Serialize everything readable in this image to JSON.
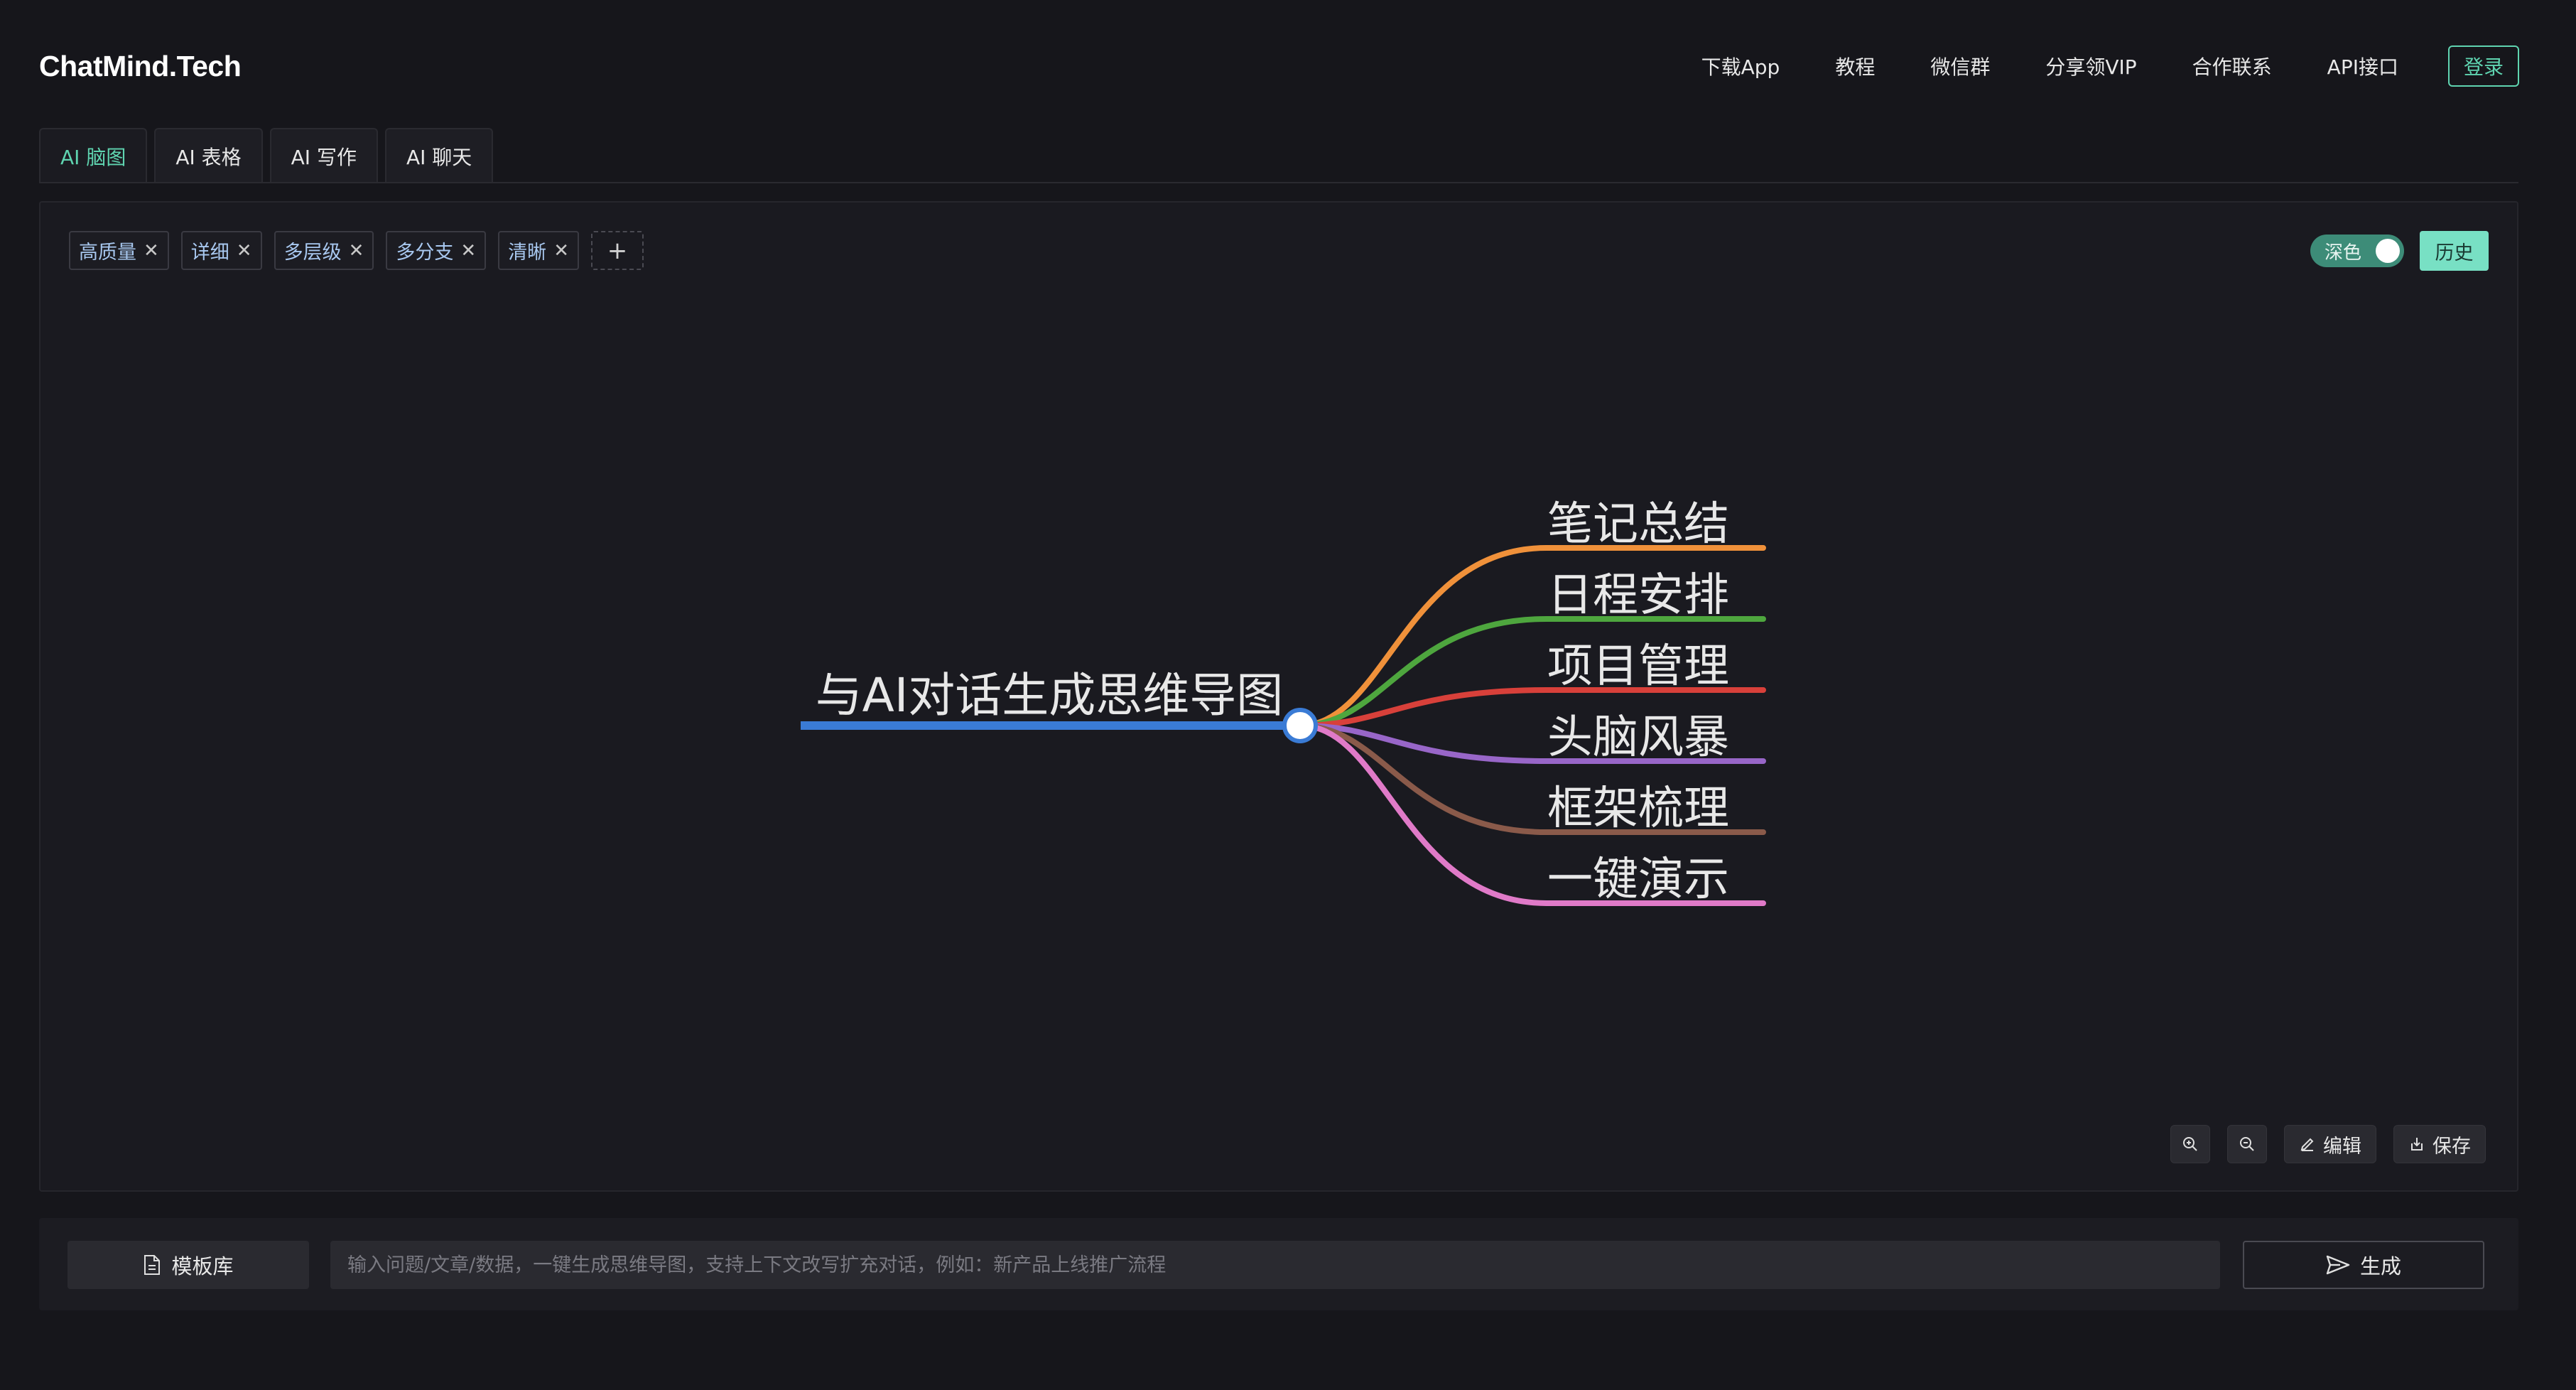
{
  "app": {
    "logo": "ChatMind.Tech"
  },
  "nav": {
    "items": [
      "下载App",
      "教程",
      "微信群",
      "分享领VIP",
      "合作联系",
      "API接口"
    ],
    "login_label": "登录"
  },
  "tabs": [
    {
      "label": "AI 脑图",
      "active": true
    },
    {
      "label": "AI 表格",
      "active": false
    },
    {
      "label": "AI 写作",
      "active": false
    },
    {
      "label": "AI 聊天",
      "active": false
    }
  ],
  "tags": [
    "高质量",
    "详细",
    "多层级",
    "多分支",
    "清晰"
  ],
  "tag_add_symbol": "+",
  "theme_toggle": {
    "label": "深色",
    "on": true
  },
  "history_label": "历史",
  "mindmap": {
    "root": {
      "label": "与AI对话生成思维导图",
      "color": "#3a7bd5"
    },
    "branches": [
      {
        "label": "笔记总结",
        "color": "#f0913a"
      },
      {
        "label": "日程安排",
        "color": "#4ea63e"
      },
      {
        "label": "项目管理",
        "color": "#d8403a"
      },
      {
        "label": "头脑风暴",
        "color": "#9866c8"
      },
      {
        "label": "框架梳理",
        "color": "#8a5a4a"
      },
      {
        "label": "一键演示",
        "color": "#e07ac8"
      }
    ]
  },
  "tools": {
    "zoom_in_icon": "zoom-in-icon",
    "zoom_out_icon": "zoom-out-icon",
    "edit_label": "编辑",
    "save_label": "保存"
  },
  "bottom": {
    "template_label": "模板库",
    "input_value": "",
    "input_placeholder": "输入问题/文章/数据，一键生成思维导图，支持上下文改写扩充对话，例如：新产品上线推广流程",
    "generate_label": "生成"
  },
  "colors": {
    "accent": "#5fd4b0",
    "background": "#16161b",
    "panel": "#1a1a20"
  }
}
